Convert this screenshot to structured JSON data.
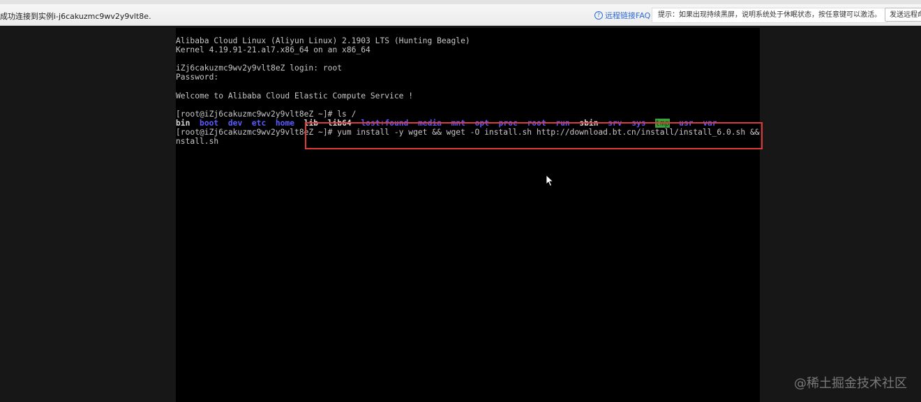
{
  "toolbar": {
    "status": "成功连接到实例i-j6cakuzmc9wv2y9vlt8e.",
    "faq_link": "远程链接FAQ",
    "tip": "提示：如果出现持续黑屏，说明系统处于休眠状态，按任意键可以激活。",
    "command_button": "发送远程命令"
  },
  "terminal": {
    "line1": "Alibaba Cloud Linux (Aliyun Linux) 2.1903 LTS (Hunting Beagle)",
    "line2": "Kernel 4.19.91-21.al7.x86_64 on an x86_64",
    "line3": "iZj6cakuzmc9wv2y9vlt8eZ login: root",
    "line4": "Password:",
    "line5": "Welcome to Alibaba Cloud Elastic Compute Service !",
    "prompt1": "[root@iZj6cakuzmc9wv2y9vlt8eZ ~]# ls /",
    "ls_output": [
      "bin",
      "boot",
      "dev",
      "etc",
      "home",
      "lib",
      "lib64",
      "lost+found",
      "media",
      "mnt",
      "opt",
      "proc",
      "root",
      "run",
      "sbin",
      "srv",
      "sys",
      "tmp",
      "usr",
      "var"
    ],
    "prompt2_prefix": "[root@iZj6cakuzmc9wv2y9vlt8eZ ~]# ",
    "command_part1": "yum install -y wget && wget -O install.sh http://download.bt.cn/install/install_6.0.sh && sh i",
    "command_part2": "nstall.sh"
  },
  "watermark": "@稀土掘金技术社区",
  "colors": {
    "highlight_box": "#e03b3b",
    "dir_blue": "#5b5bff",
    "tmp_green": "#3aa33a"
  }
}
